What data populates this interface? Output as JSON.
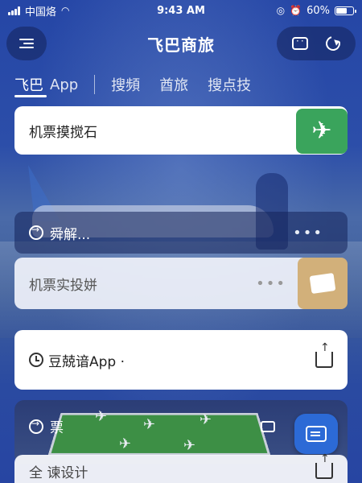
{
  "status_bar": {
    "carrier": "中国烙",
    "time": "9:43 AM",
    "battery": "60%"
  },
  "header": {
    "title": "飞巴商旅"
  },
  "tabs": [
    {
      "label": "飞巴"
    },
    {
      "label": "App"
    },
    {
      "label": "搜頻"
    },
    {
      "label": "酋旅"
    },
    {
      "label": "搜点技"
    }
  ],
  "cards": {
    "flight_search": {
      "label": "机票摸搅石"
    },
    "explain": {
      "label": "舜解...",
      "dots": "•••"
    },
    "flight_booking": {
      "label": "机票实投姘",
      "dots": "•••"
    },
    "app_history": {
      "label": "豆兢谙App",
      "suffix": "·"
    },
    "ticket": {
      "label": "票"
    },
    "design": {
      "label": "全 谏设计"
    }
  },
  "colors": {
    "green_tile": "#3aa45c",
    "gold_tile": "#d2b07a",
    "float_button": "#2c6ad6"
  }
}
